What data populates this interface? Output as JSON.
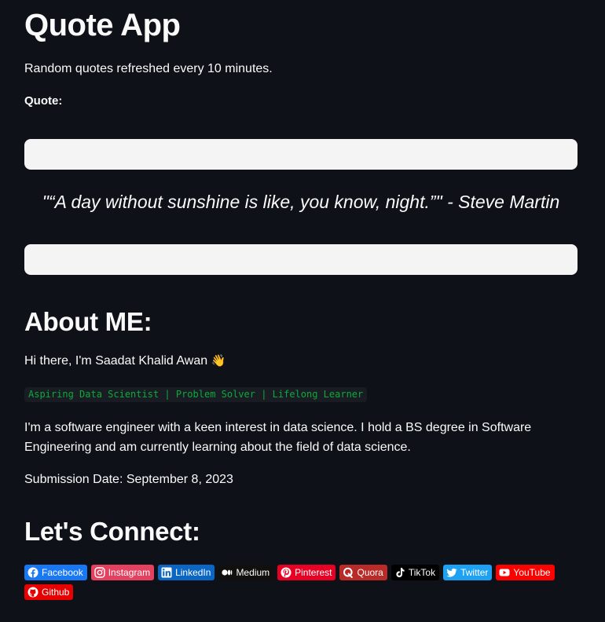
{
  "header": {
    "title": "Quote App",
    "subtitle": "Random quotes refreshed every 10 minutes.",
    "quote_label": "Quote:"
  },
  "quote": {
    "text": "\"“A day without sunshine is like, you know, night.”\" - Steve Martin"
  },
  "about": {
    "heading": "About ME:",
    "greeting": "Hi there, I'm Saadat Khalid Awan",
    "wave_emoji": "👋",
    "tagline": "Aspiring Data Scientist | Problem Solver | Lifelong Learner",
    "bio": "I'm a software engineer with a keen interest in data science. I hold a BS degree in Software Engineering and am currently learning about the field of data science.",
    "submission": "Submission Date: September 8, 2023"
  },
  "connect": {
    "heading": "Let's Connect:",
    "badges": [
      {
        "label": "Facebook",
        "icon": "facebook-icon",
        "color": "#1877f2"
      },
      {
        "label": "Instagram",
        "icon": "instagram-icon",
        "color": "#e4405f"
      },
      {
        "label": "LinkedIn",
        "icon": "linkedin-icon",
        "color": "#0a66c2"
      },
      {
        "label": "Medium",
        "icon": "medium-icon",
        "color": "#12100e"
      },
      {
        "label": "Pinterest",
        "icon": "pinterest-icon",
        "color": "#e60023"
      },
      {
        "label": "Quora",
        "icon": "quora-icon",
        "color": "#b92b27"
      },
      {
        "label": "TikTok",
        "icon": "tiktok-icon",
        "color": "#000000"
      },
      {
        "label": "Twitter",
        "icon": "twitter-icon",
        "color": "#1da1f2"
      },
      {
        "label": "YouTube",
        "icon": "youtube-icon",
        "color": "#ff0000"
      },
      {
        "label": "Github",
        "icon": "github-icon",
        "color": "#e60000"
      }
    ]
  },
  "colors": {
    "background": "#0e1117",
    "text": "#fafafa",
    "bar": "#f4f4f4",
    "code_text": "#09ab3b",
    "code_bg": "#1a1c24"
  }
}
